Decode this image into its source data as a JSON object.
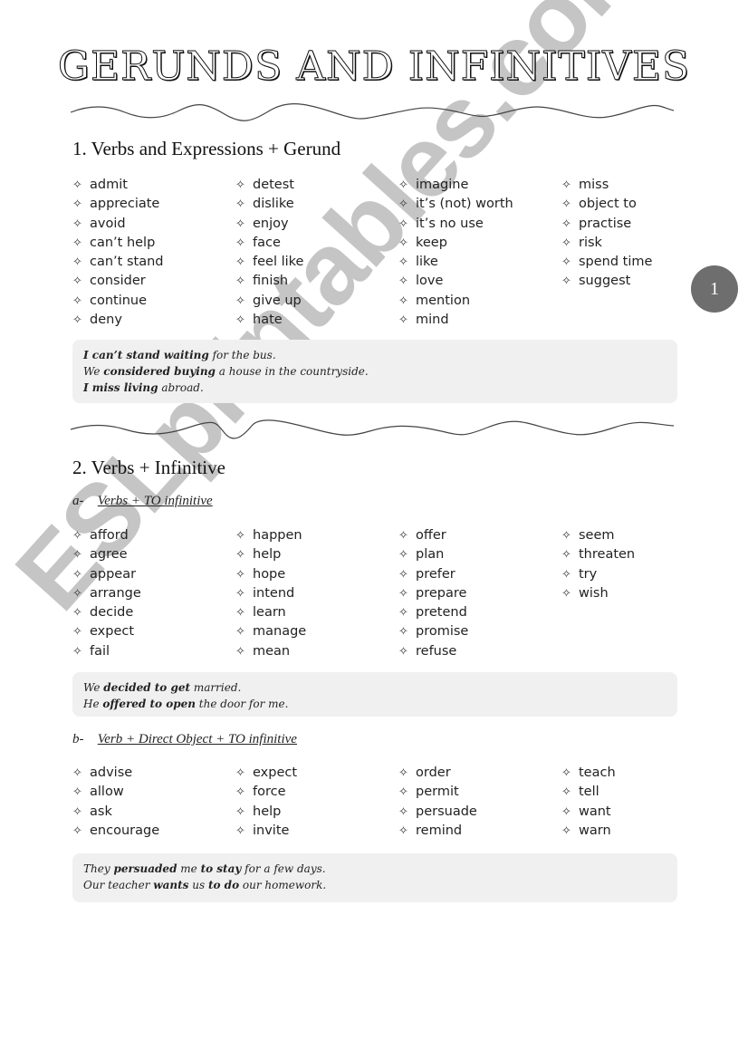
{
  "title": "GERUNDS AND INFINITIVES",
  "page_badge": "1",
  "bullet_icon": "✧",
  "watermark": "ESLprintables.com",
  "section1": {
    "heading": "1.  Verbs and Expressions + Gerund",
    "columns": [
      [
        "admit",
        "appreciate",
        "avoid",
        "can’t help",
        "can’t stand",
        "consider",
        "continue",
        "deny"
      ],
      [
        "detest",
        "dislike",
        "enjoy",
        "face",
        "feel like",
        "finish",
        "give up",
        "hate"
      ],
      [
        "imagine",
        "it’s (not) worth",
        "it’s no use",
        "keep",
        "like",
        "love",
        "mention",
        "mind"
      ],
      [
        "miss",
        "object to",
        "practise",
        "risk",
        "spend time",
        "suggest"
      ]
    ],
    "examples": [
      [
        {
          "t": "I can’t stand waiting",
          "b": true
        },
        {
          "t": " for the bus.",
          "b": false
        }
      ],
      [
        {
          "t": "We ",
          "b": false
        },
        {
          "t": "considered buying",
          "b": true
        },
        {
          "t": " a house in the countryside.",
          "b": false
        }
      ],
      [
        {
          "t": "I miss living",
          "b": true
        },
        {
          "t": " abroad.",
          "b": false
        }
      ]
    ]
  },
  "section2": {
    "heading": "2.  Verbs + Infinitive",
    "sub_a": {
      "label": "a-",
      "title": "Verbs + TO infinitive",
      "columns": [
        [
          "afford",
          "agree",
          "appear",
          "arrange",
          "decide",
          "expect",
          "fail"
        ],
        [
          "happen",
          "help",
          "hope",
          "intend",
          "learn",
          "manage",
          "mean"
        ],
        [
          "offer",
          "plan",
          "prefer",
          "prepare",
          "pretend",
          "promise",
          "refuse"
        ],
        [
          "seem",
          "threaten",
          "try",
          "wish"
        ]
      ],
      "examples": [
        [
          {
            "t": "We ",
            "b": false
          },
          {
            "t": "decided to get",
            "b": true
          },
          {
            "t": " married.",
            "b": false
          }
        ],
        [
          {
            "t": "He ",
            "b": false
          },
          {
            "t": "offered to open",
            "b": true
          },
          {
            "t": " the door for me.",
            "b": false
          }
        ]
      ]
    },
    "sub_b": {
      "label": "b-",
      "title": "Verb + Direct Object + TO infinitive",
      "columns": [
        [
          "advise",
          "allow",
          "ask",
          "encourage"
        ],
        [
          "expect",
          "force",
          "help",
          "invite"
        ],
        [
          "order",
          "permit",
          "persuade",
          "remind"
        ],
        [
          "teach",
          "tell",
          "want",
          "warn"
        ]
      ],
      "examples": [
        [
          {
            "t": "They ",
            "b": false
          },
          {
            "t": "persuaded",
            "b": true
          },
          {
            "t": " me ",
            "b": false
          },
          {
            "t": "to stay",
            "b": true
          },
          {
            "t": " for a few days.",
            "b": false
          }
        ],
        [
          {
            "t": "Our teacher ",
            "b": false
          },
          {
            "t": "wants",
            "b": true
          },
          {
            "t": " us ",
            "b": false
          },
          {
            "t": "to do",
            "b": true
          },
          {
            "t": " our homework.",
            "b": false
          }
        ]
      ]
    }
  }
}
